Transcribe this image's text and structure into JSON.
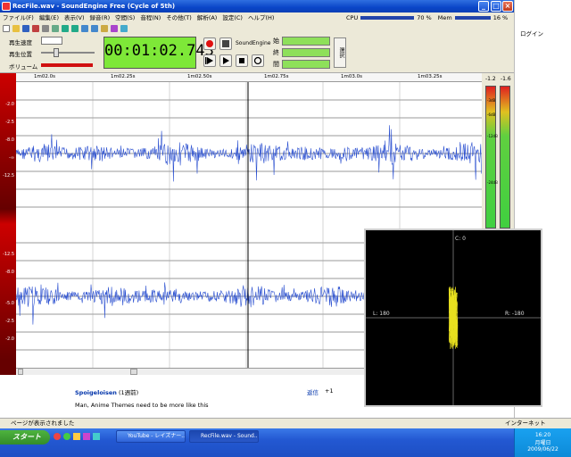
{
  "window": {
    "title": "RecFile.wav - SoundEngine Free (Cycle of 5th)",
    "buttons": [
      "_",
      "□",
      "×"
    ]
  },
  "menu": [
    "ファイル(F)",
    "編集(E)",
    "表示(V)",
    "録音(R)",
    "空間(S)",
    "音程(N)",
    "その他(T)",
    "解析(A)",
    "設定(C)",
    "ヘルプ(H)"
  ],
  "cpu": {
    "label": "CPU",
    "percent": "70 %",
    "mem_label": "Mem",
    "mem_percent": "16 %"
  },
  "controls": {
    "speed_label": "再生速度",
    "position_label": "再生位置",
    "volume_label": "ボリューム",
    "time": "00:01:02.743",
    "engine_label": "SoundEngine",
    "field_labels": [
      "始",
      "終",
      "間"
    ],
    "side_button": "選択"
  },
  "timeline": [
    "1m02.0s",
    "1m02.25s",
    "1m02.50s",
    "1m02.75s",
    "1m03.0s",
    "1m03.25s"
  ],
  "db_labels": [
    "-2.0",
    "-2.5",
    "-8.0",
    "-12.5",
    "-∞",
    "-12.5",
    "-8.0",
    "-5.0",
    "-2.5",
    "-2.0"
  ],
  "meters": {
    "left_value": "-1.2",
    "right_value": "-1.6",
    "marks": [
      "-3dB",
      "-6dB",
      "-12dB",
      "-24dB"
    ]
  },
  "scope": {
    "top": "C: 0",
    "left": "L: 180",
    "right": "R: -180"
  },
  "comment": {
    "user": "Spoigeloisen",
    "age": "(1週前)",
    "text": "Man, Anime Themes need to be more like this",
    "reply": "返信",
    "score": "+1"
  },
  "sidebar": {
    "login": "ログイン"
  },
  "statusbar": {
    "text": "ページが表示されました",
    "zone": "インターネット"
  },
  "taskbar": {
    "start": "スタート",
    "tasks": [
      "YouTube - レイズナー...",
      "RecFile.wav - Sound..."
    ],
    "clock": "16:20",
    "day": "月曜日",
    "date": "2009/06/22"
  }
}
